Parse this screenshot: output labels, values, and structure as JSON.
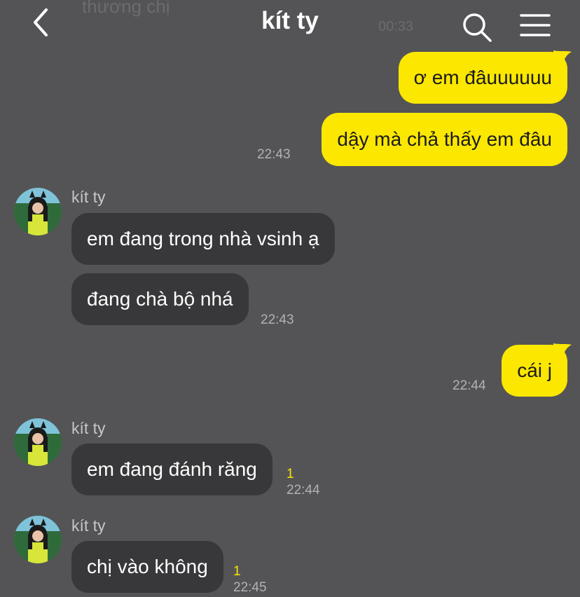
{
  "header": {
    "title": "kít ty",
    "ghost_text": "thương chị",
    "ghost_time": "00:33",
    "back_icon": "chevron-left-icon",
    "search_icon": "search-icon",
    "menu_icon": "hamburger-menu-icon"
  },
  "colors": {
    "background": "#545456",
    "my_bubble": "#fbe700",
    "their_bubble": "#38383a",
    "unread": "#fbe700"
  },
  "messages": [
    {
      "from": "me",
      "text": "ơ em đâuuuuuu"
    },
    {
      "from": "me",
      "text": "dậy mà chả thấy em đâu",
      "time": "22:43"
    },
    {
      "from": "them",
      "sender": "kít ty",
      "text": "em đang trong nhà vsinh ạ"
    },
    {
      "from": "them",
      "text": "đang chà bộ nhá",
      "time": "22:43"
    },
    {
      "from": "me",
      "text": "cái j",
      "time": "22:44"
    },
    {
      "from": "them",
      "sender": "kít ty",
      "text": "em đang đánh răng",
      "unread": "1",
      "time": "22:44"
    },
    {
      "from": "them",
      "sender": "kít ty",
      "text": "chị vào không",
      "unread": "1",
      "time": "22:45"
    }
  ]
}
